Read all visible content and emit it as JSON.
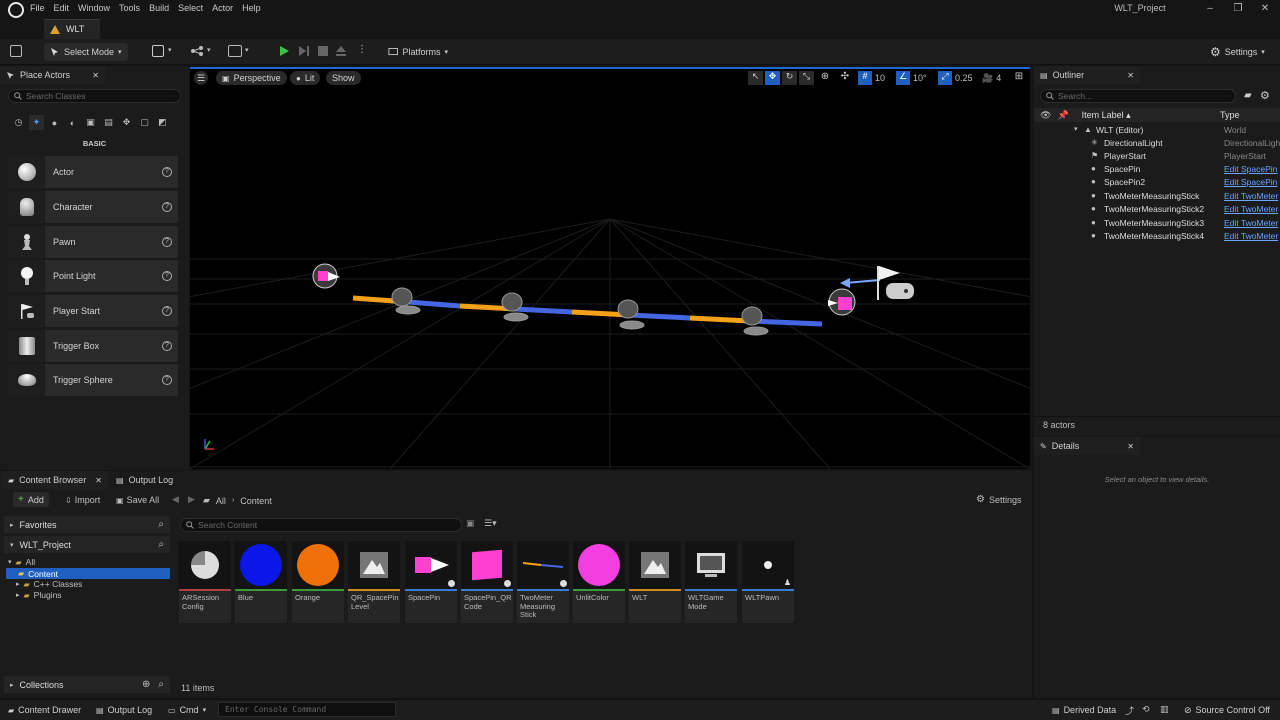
{
  "menu": [
    "File",
    "Edit",
    "Window",
    "Tools",
    "Build",
    "Select",
    "Actor",
    "Help"
  ],
  "window_title": "WLT_Project",
  "doc_tab": "WLT",
  "toolbar": {
    "select_mode": "Select Mode",
    "platforms": "Platforms",
    "settings": "Settings"
  },
  "place_actors": {
    "tab": "Place Actors",
    "search_placeholder": "Search Classes",
    "section": "BASIC",
    "items": [
      "Actor",
      "Character",
      "Pawn",
      "Point Light",
      "Player Start",
      "Trigger Box",
      "Trigger Sphere"
    ]
  },
  "viewport": {
    "perspective": "Perspective",
    "lit": "Lit",
    "show": "Show",
    "grid": "10",
    "angle": "10°",
    "scale": "0.25",
    "camera": "4"
  },
  "outliner": {
    "tab": "Outliner",
    "search_placeholder": "Search...",
    "col_label": "Item Label ▴",
    "col_type": "Type",
    "rows": [
      {
        "label": "WLT (Editor)",
        "type": "World",
        "link": false
      },
      {
        "label": "DirectionalLight",
        "type": "DirectionalLight",
        "link": false
      },
      {
        "label": "PlayerStart",
        "type": "PlayerStart",
        "link": false
      },
      {
        "label": "SpacePin",
        "type": "Edit SpacePin",
        "link": true
      },
      {
        "label": "SpacePin2",
        "type": "Edit SpacePin",
        "link": true
      },
      {
        "label": "TwoMeterMeasuringStick",
        "type": "Edit TwoMeter",
        "link": true
      },
      {
        "label": "TwoMeterMeasuringStick2",
        "type": "Edit TwoMeter",
        "link": true
      },
      {
        "label": "TwoMeterMeasuringStick3",
        "type": "Edit TwoMeter",
        "link": true
      },
      {
        "label": "TwoMeterMeasuringStick4",
        "type": "Edit TwoMeter",
        "link": true
      }
    ],
    "count": "8 actors"
  },
  "details": {
    "tab": "Details",
    "empty": "Select an object to view details."
  },
  "content_browser": {
    "tab": "Content Browser",
    "output_tab": "Output Log",
    "add": "Add",
    "import": "Import",
    "save_all": "Save All",
    "breadcrumb": [
      "All",
      "Content"
    ],
    "settings": "Settings",
    "favorites": "Favorites",
    "project": "WLT_Project",
    "tree": [
      "All",
      "Content",
      "C++ Classes",
      "Plugins"
    ],
    "search_placeholder": "Search Content",
    "collections": "Collections",
    "item_count": "11 items",
    "assets": [
      {
        "label": "ARSession Config",
        "strip": "#b04040"
      },
      {
        "label": "Blue",
        "strip": "#3a9a3a"
      },
      {
        "label": "Orange",
        "strip": "#3a9a3a"
      },
      {
        "label": "QR_SpacePin Level",
        "strip": "#d08a20"
      },
      {
        "label": "SpacePin",
        "strip": "#3a7ad0"
      },
      {
        "label": "SpacePin_QR Code",
        "strip": "#3a7ad0"
      },
      {
        "label": "TwoMeter Measuring Stick",
        "strip": "#3a7ad0"
      },
      {
        "label": "UnlitColor",
        "strip": "#3a9a3a"
      },
      {
        "label": "WLT",
        "strip": "#d08a20"
      },
      {
        "label": "WLTGame Mode",
        "strip": "#3a7ad0"
      },
      {
        "label": "WLTPawn",
        "strip": "#3a7ad0"
      }
    ]
  },
  "statusbar": {
    "content_drawer": "Content Drawer",
    "output_log": "Output Log",
    "cmd": "Cmd",
    "console_placeholder": "Enter Console Command",
    "derived_data": "Derived Data",
    "source_control": "Source Control Off"
  }
}
